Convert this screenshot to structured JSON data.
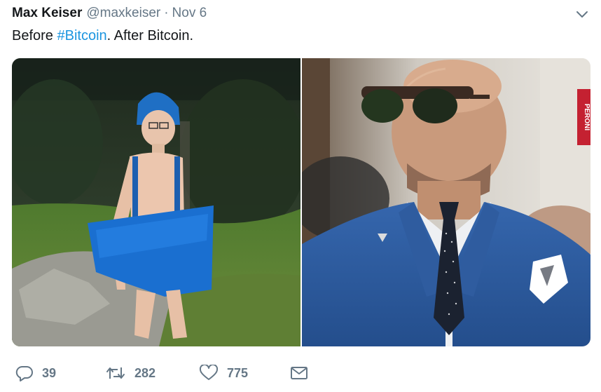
{
  "tweet": {
    "display_name": "Max Keiser",
    "handle": "@maxkeiser",
    "separator": "·",
    "date": "Nov 6",
    "text_before": "Before ",
    "hashtag": "#Bitcoin",
    "text_after": ". After Bitcoin."
  },
  "photos": {
    "right_banner_text": "PERONI"
  },
  "actions": {
    "replies": "39",
    "retweets": "282",
    "likes": "775"
  },
  "colors": {
    "link": "#1b95e0",
    "muted": "#657786",
    "text": "#14171a"
  },
  "icons": [
    "chevron-down-icon",
    "reply-icon",
    "retweet-icon",
    "heart-icon",
    "envelope-icon"
  ]
}
